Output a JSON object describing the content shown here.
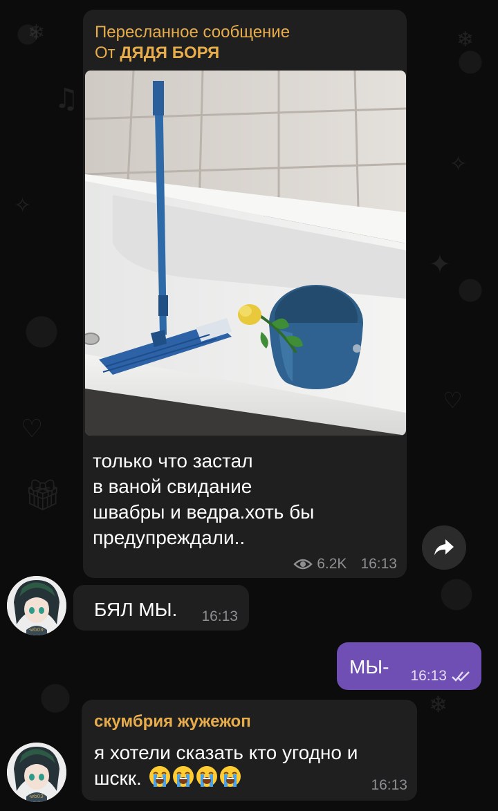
{
  "colors": {
    "background": "#0c0c0d",
    "bubble_incoming": "#1f1f1f",
    "bubble_outgoing": "#6f4fb3",
    "sender_name": "#e7ad4c",
    "meta_text": "#8e8e93"
  },
  "forwarded_message": {
    "header_label": "Пересланное сообщение",
    "from_prefix": "От",
    "from_name": "ДЯДЯ БОРЯ",
    "photo_icon": "photo-mop-and-bucket-in-bathtub",
    "text_lines": [
      "только что застал",
      "в ваной свидание",
      "швабры и ведра.хоть бы",
      "предупреждали.."
    ],
    "views": "6.2K",
    "time": "16:13",
    "share_icon": "share-arrow-icon"
  },
  "incoming_message_1": {
    "text": "БЯЛ МЫ.",
    "time": "16:13"
  },
  "outgoing_message": {
    "text": "МЫ-",
    "time": "16:13",
    "status_icon": "double-check-icon"
  },
  "incoming_message_2": {
    "sender": "скумбрия жужежоп",
    "text_line_1": "я хотели сказать кто угодно и",
    "text_line_2": "шскк.",
    "emoji": [
      "loudly-crying-face",
      "loudly-crying-face",
      "loudly-crying-face",
      "loudly-crying-face"
    ],
    "time": "16:13"
  }
}
